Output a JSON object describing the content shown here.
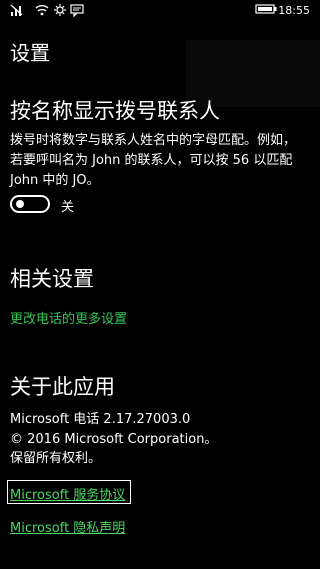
{
  "status_bar": {
    "icons": [
      "signal-off-icon",
      "wifi-icon",
      "settings-icon",
      "notification-icon",
      "battery-icon"
    ],
    "time": "18:55"
  },
  "page": {
    "title": "设置"
  },
  "dial_section": {
    "heading": "按名称显示拨号联系人",
    "description_line1": "拨号时将数字与联系人姓名中的字母匹配。例如，",
    "description_line2": "若要呼叫名为 John 的联系人，可以按 56 以匹配",
    "description_line3": "John 中的 JO。",
    "toggle_state": "关"
  },
  "related_section": {
    "heading": "相关设置",
    "link": "更改电话的更多设置"
  },
  "about_section": {
    "heading": "关于此应用",
    "app_version": "Microsoft 电话 2.17.27003.0",
    "copyright": "© 2016 Microsoft Corporation。",
    "rights": "保留所有权利。",
    "service_link": "Microsoft 服务协议",
    "privacy_link": "Microsoft 隐私声明"
  },
  "colors": {
    "accent": "#34c759",
    "background": "#000000",
    "text": "#ffffff"
  }
}
